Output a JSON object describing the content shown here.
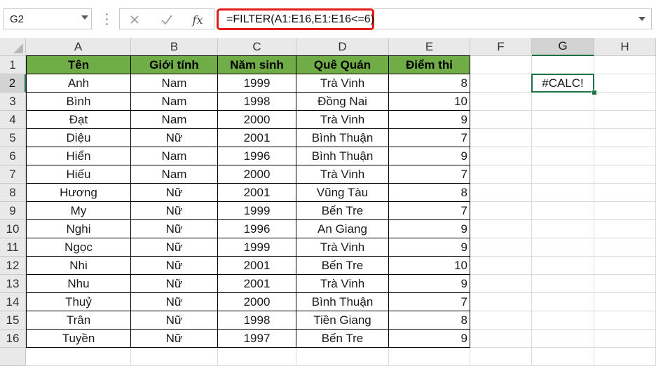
{
  "namebox": {
    "value": "G2"
  },
  "formula_bar": {
    "formula": "=FILTER(A1:E16,E1:E16<=6)",
    "fx_label": "fx"
  },
  "icons": {
    "cancel": "close-icon",
    "enter": "check-icon",
    "insert_function": "fx-icon",
    "namebox_dropdown": "chevron-down-icon",
    "expand": "chevron-down-icon"
  },
  "colors": {
    "header_fill": "#70ad47",
    "selection": "#1e7145",
    "formula_highlight": "#e21a1a"
  },
  "columns": [
    "A",
    "B",
    "C",
    "D",
    "E",
    "F",
    "G",
    "H"
  ],
  "rows": [
    "1",
    "2",
    "3",
    "4",
    "5",
    "6",
    "7",
    "8",
    "9",
    "10",
    "11",
    "12",
    "13",
    "14",
    "15",
    "16",
    ""
  ],
  "table": {
    "headers": [
      "Tên",
      "Giới tính",
      "Năm sinh",
      "Quê Quán",
      "Điểm thi"
    ],
    "rows": [
      [
        "Anh",
        "Nam",
        "1999",
        "Trà Vinh",
        "8"
      ],
      [
        "Bình",
        "Nam",
        "1998",
        "Đồng Nai",
        "10"
      ],
      [
        "Đạt",
        "Nam",
        "2000",
        "Trà Vinh",
        "9"
      ],
      [
        "Diệu",
        "Nữ",
        "2001",
        "Bình Thuận",
        "7"
      ],
      [
        "Hiển",
        "Nam",
        "1996",
        "Bình Thuận",
        "9"
      ],
      [
        "Hiếu",
        "Nam",
        "2000",
        "Trà Vinh",
        "7"
      ],
      [
        "Hương",
        "Nữ",
        "2001",
        "Vũng Tàu",
        "8"
      ],
      [
        "My",
        "Nữ",
        "1999",
        "Bến Tre",
        "7"
      ],
      [
        "Nghi",
        "Nữ",
        "1996",
        "An Giang",
        "9"
      ],
      [
        "Ngọc",
        "Nữ",
        "1999",
        "Trà Vinh",
        "9"
      ],
      [
        "Nhi",
        "Nữ",
        "2001",
        "Bến Tre",
        "10"
      ],
      [
        "Nhu",
        "Nữ",
        "2001",
        "Trà Vinh",
        "9"
      ],
      [
        "Thuỷ",
        "Nữ",
        "2000",
        "Bình Thuận",
        "7"
      ],
      [
        "Trân",
        "Nữ",
        "1998",
        "Tiền Giang",
        "8"
      ],
      [
        "Tuyền",
        "Nữ",
        "1997",
        "Bến Tre",
        "9"
      ]
    ]
  },
  "active_cell": {
    "ref": "G2",
    "value": "#CALC!"
  }
}
